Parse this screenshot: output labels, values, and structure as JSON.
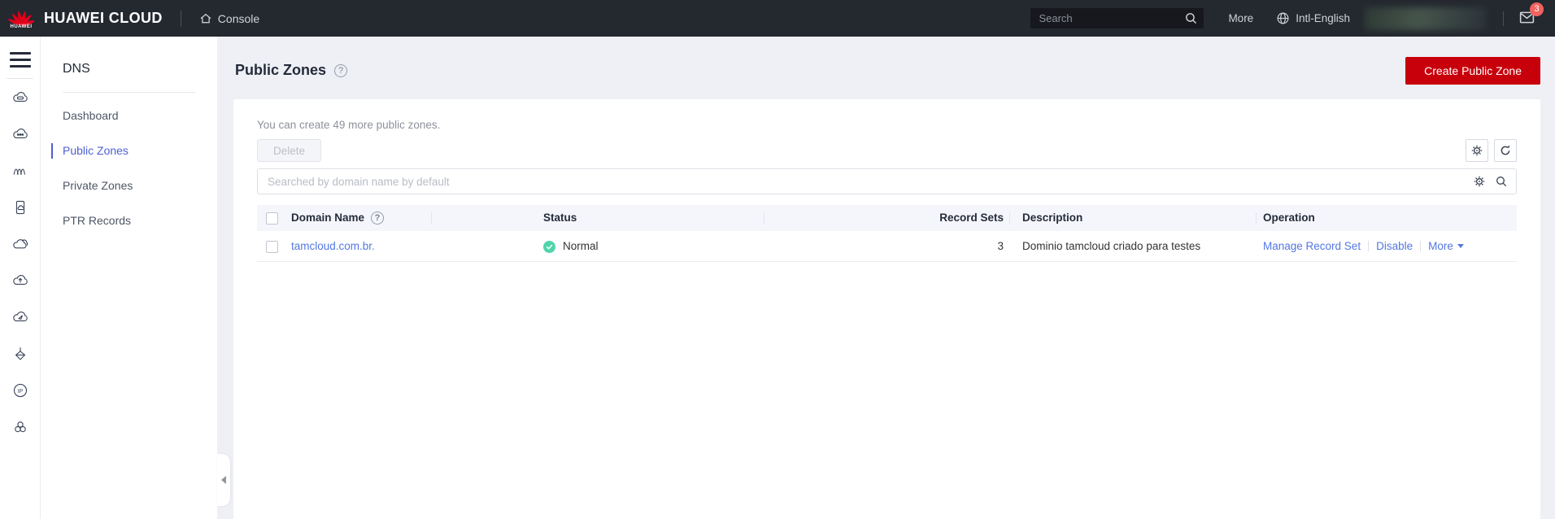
{
  "header": {
    "logo_label": "HUAWEI",
    "brand": "HUAWEI CLOUD",
    "console_label": "Console",
    "search_placeholder": "Search",
    "more_label": "More",
    "language_label": "Intl-English",
    "notification_count": "3"
  },
  "icon_rail": {
    "icons": [
      "menu",
      "cloud-server",
      "cloud-dots",
      "waves",
      "device-cloud",
      "cloud",
      "cloud-upload",
      "cloud-play",
      "beacon",
      "eip",
      "cluster"
    ]
  },
  "nav": {
    "title": "DNS",
    "items": [
      {
        "label": "Dashboard",
        "active": false
      },
      {
        "label": "Public Zones",
        "active": true
      },
      {
        "label": "Private Zones",
        "active": false
      },
      {
        "label": "PTR Records",
        "active": false
      }
    ]
  },
  "page": {
    "title": "Public Zones",
    "create_button": "Create Public Zone",
    "quota_hint": "You can create 49 more public zones.",
    "delete_button": "Delete",
    "search_placeholder": "Searched by domain name by default"
  },
  "table": {
    "columns": [
      "Domain Name",
      "Status",
      "Record Sets",
      "Description",
      "Operation"
    ],
    "rows": [
      {
        "domain": "tamcloud.com.br.",
        "status": "Normal",
        "record_sets": "3",
        "description": "Dominio tamcloud criado para testes",
        "operations": [
          "Manage Record Set",
          "Disable",
          "More"
        ]
      }
    ]
  },
  "icons": {
    "question_glyph": "?"
  },
  "colors": {
    "header_bg": "#24282f",
    "accent_red": "#c7000b",
    "nav_active_blue": "#4d5fd3",
    "link_blue": "#5377e2",
    "status_green": "#50d4ab",
    "badge_red": "#f2635f",
    "page_bg": "#eef0f5",
    "table_header_bg": "#f4f6fb"
  }
}
